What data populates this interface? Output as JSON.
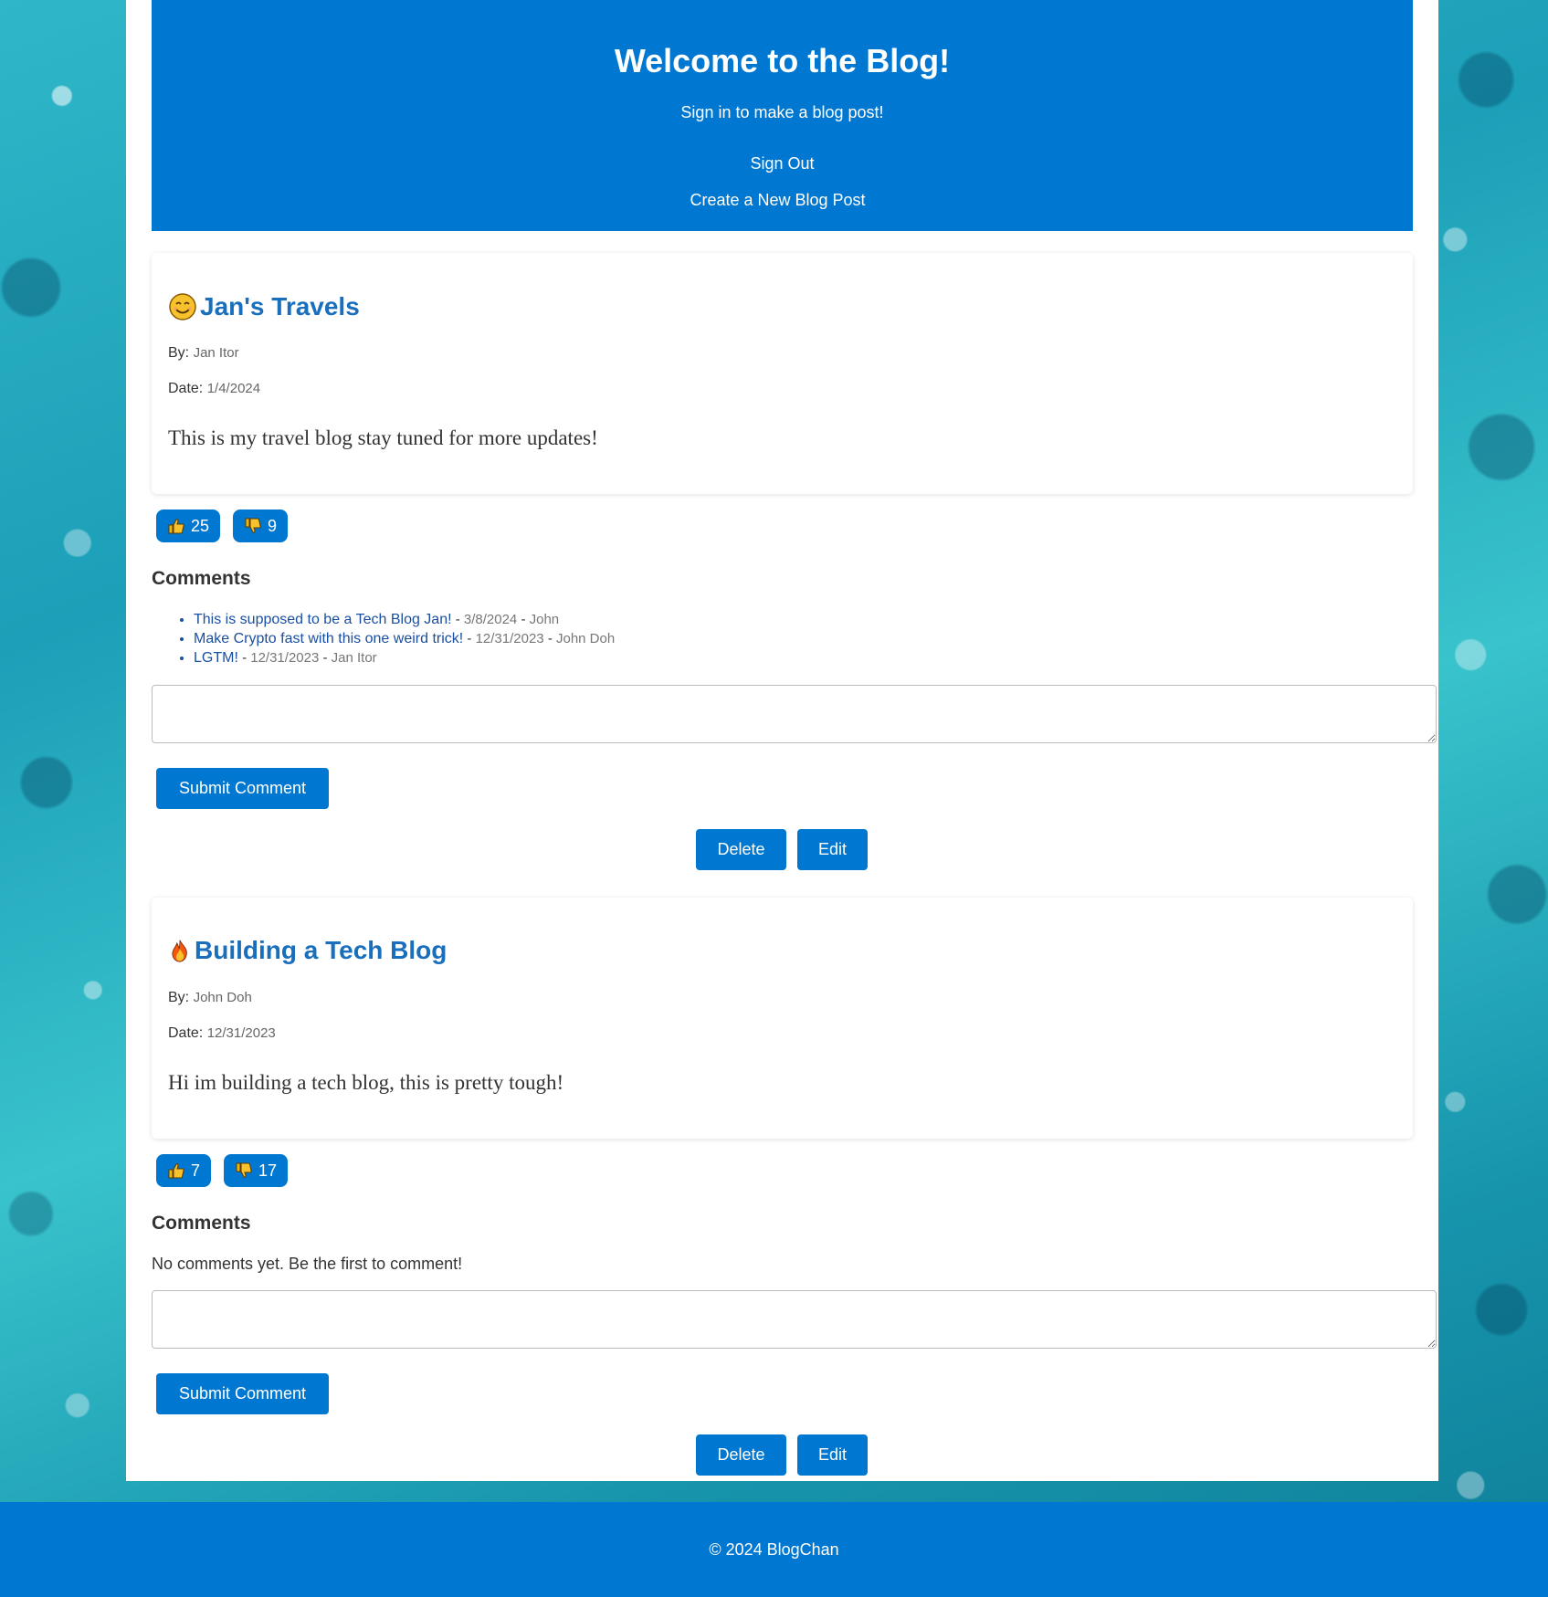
{
  "header": {
    "title": "Welcome to the Blog!",
    "subtitle": "Sign in to make a blog post!",
    "sign_out": "Sign Out",
    "create_post": "Create a New Blog Post"
  },
  "posts": [
    {
      "emoji": "smiling-face-icon",
      "title": "Jan's Travels",
      "by_label": "By:",
      "author": "Jan Itor",
      "date_label": "Date:",
      "date": "1/4/2024",
      "body": "This is my travel blog stay tuned for more updates!",
      "likes": "25",
      "dislikes": "9",
      "comments_heading": "Comments",
      "comments": [
        {
          "text": "This is supposed to be a Tech Blog Jan!",
          "date": "3/8/2024",
          "author": "John"
        },
        {
          "text": "Make Crypto fast with this one weird trick!",
          "date": "12/31/2023",
          "author": "John Doh"
        },
        {
          "text": "LGTM!",
          "date": "12/31/2023",
          "author": "Jan Itor"
        }
      ],
      "submit_label": "Submit Comment",
      "delete_label": "Delete",
      "edit_label": "Edit"
    },
    {
      "emoji": "fire-icon",
      "title": "Building a Tech Blog",
      "by_label": "By:",
      "author": "John Doh",
      "date_label": "Date:",
      "date": "12/31/2023",
      "body": "Hi im building a tech blog, this is pretty tough!",
      "likes": "7",
      "dislikes": "17",
      "comments_heading": "Comments",
      "no_comments": "No comments yet. Be the first to comment!",
      "submit_label": "Submit Comment",
      "delete_label": "Delete",
      "edit_label": "Edit"
    }
  ],
  "separator": "-",
  "footer": {
    "text": "© 2024 BlogChan"
  },
  "colors": {
    "primary": "#0077d0",
    "title_link": "#1a6fbd",
    "comment_link": "#1a4fa0"
  }
}
